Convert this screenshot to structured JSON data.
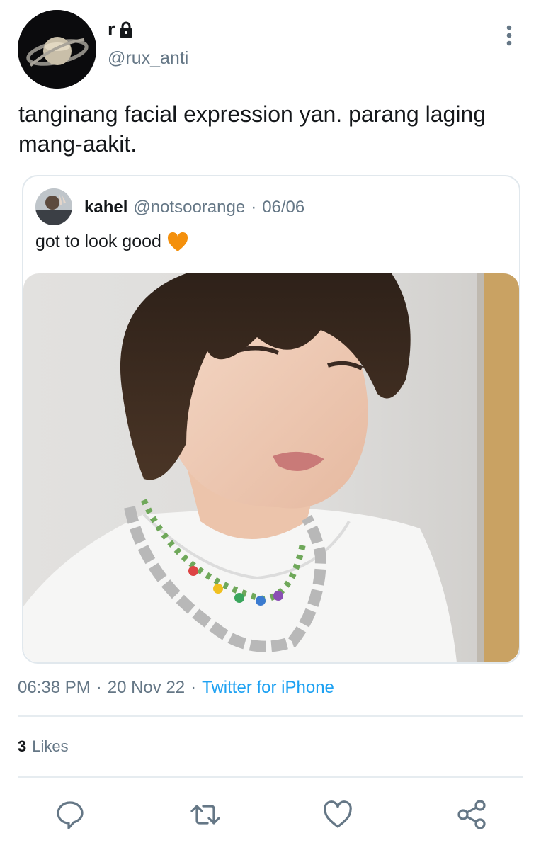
{
  "author": {
    "display_name": "r",
    "handle": "@rux_anti",
    "avatar_icon": "saturn-avatar",
    "protected_icon": "lock-icon"
  },
  "tweet": {
    "text": "tanginang facial expression yan. parang laging mang-aakit."
  },
  "quoted": {
    "name": "kahel",
    "handle": "@notsoorange",
    "separator": "·",
    "date": "06/06",
    "text": "got to look good",
    "emoji": "orange-heart-emoji",
    "photo": "selfie-photo"
  },
  "meta": {
    "time": "06:38 PM",
    "separator": "·",
    "date": "20 Nov 22",
    "separator2": "·",
    "source": "Twitter for iPhone"
  },
  "stats": {
    "likes_count": "3",
    "likes_label": "Likes"
  },
  "actions": [
    "reply-icon",
    "retweet-icon",
    "like-icon",
    "share-icon"
  ],
  "colors": {
    "accent": "#1da1f2",
    "secondary_text": "#657786",
    "border": "#e1e8ed",
    "heart": "#f4900c"
  }
}
